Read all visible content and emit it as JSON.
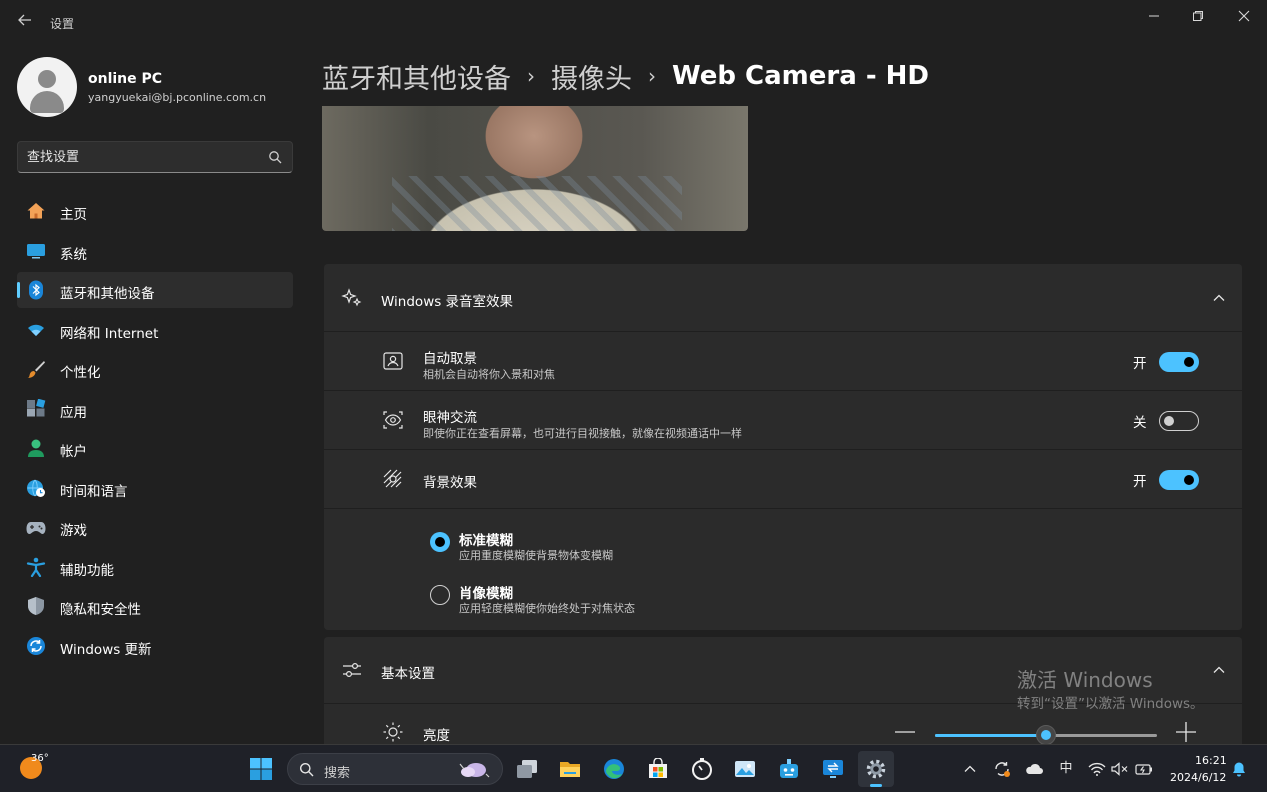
{
  "window": {
    "title": "设置",
    "back_icon": "back-arrow-icon",
    "controls": [
      "minimize",
      "restore",
      "close"
    ]
  },
  "profile": {
    "name": "online PC",
    "email": "yangyuekai@bj.pconline.com.cn"
  },
  "search": {
    "placeholder": "查找设置"
  },
  "sidebar": {
    "items": [
      {
        "label": "主页",
        "icon": "home-icon",
        "active": false
      },
      {
        "label": "系统",
        "icon": "system-display-icon",
        "active": false
      },
      {
        "label": "蓝牙和其他设备",
        "icon": "bluetooth-icon",
        "active": true
      },
      {
        "label": "网络和 Internet",
        "icon": "wifi-icon",
        "active": false
      },
      {
        "label": "个性化",
        "icon": "brush-icon",
        "active": false
      },
      {
        "label": "应用",
        "icon": "apps-icon",
        "active": false
      },
      {
        "label": "帐户",
        "icon": "account-icon",
        "active": false
      },
      {
        "label": "时间和语言",
        "icon": "globe-clock-icon",
        "active": false
      },
      {
        "label": "游戏",
        "icon": "gamepad-icon",
        "active": false
      },
      {
        "label": "辅助功能",
        "icon": "accessibility-icon",
        "active": false
      },
      {
        "label": "隐私和安全性",
        "icon": "shield-icon",
        "active": false
      },
      {
        "label": "Windows 更新",
        "icon": "windows-update-icon",
        "active": false
      }
    ]
  },
  "breadcrumb": {
    "items": [
      "蓝牙和其他设备",
      "摄像头"
    ],
    "current": "Web Camera - HD"
  },
  "studio_effects": {
    "header": "Windows 录音室效果",
    "expanded": true,
    "auto_framing": {
      "title": "自动取景",
      "subtitle": "相机会自动将你入景和对焦",
      "state_label": "开",
      "on": true
    },
    "eye_contact": {
      "title": "眼神交流",
      "subtitle": "即使你正在查看屏幕，也可进行目视接触，就像在视频通话中一样",
      "state_label": "关",
      "on": false
    },
    "background_effects": {
      "title": "背景效果",
      "state_label": "开",
      "on": true,
      "options": [
        {
          "title": "标准模糊",
          "subtitle": "应用重度模糊使背景物体变模糊",
          "selected": true
        },
        {
          "title": "肖像模糊",
          "subtitle": "应用轻度模糊使你始终处于对焦状态",
          "selected": false
        }
      ]
    }
  },
  "basic_settings": {
    "header": "基本设置",
    "expanded": true,
    "brightness": {
      "label": "亮度",
      "value_fraction": 0.5
    }
  },
  "watermark": {
    "line1": "激活 Windows",
    "line2": "转到“设置”以激活 Windows。"
  },
  "taskbar": {
    "weather_temp": "36°",
    "search_label": "搜索",
    "apps": [
      "start",
      "task-view",
      "file-explorer",
      "edge",
      "store",
      "clock-app",
      "photos",
      "copilot-robot",
      "remote-desktop",
      "settings"
    ],
    "tray": {
      "ime": "中",
      "time": "16:21",
      "date": "2024/6/12"
    }
  },
  "colors": {
    "accent": "#4cc2ff",
    "background": "#202020",
    "card": "#2b2b2b"
  }
}
